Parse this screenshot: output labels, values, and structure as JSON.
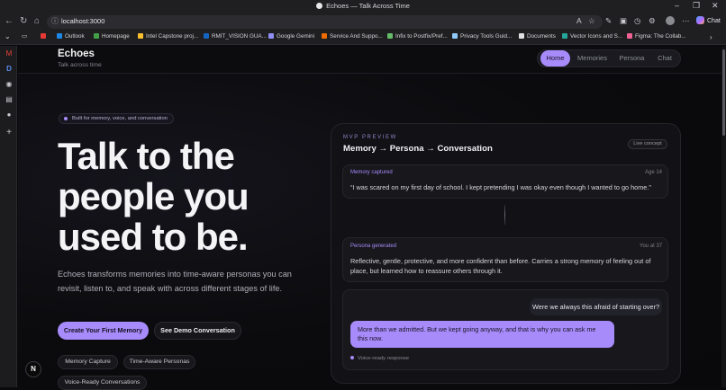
{
  "window": {
    "title": "Echoes — Talk Across Time",
    "controls": [
      "–",
      "❐",
      "✕"
    ]
  },
  "browser": {
    "url": "localhost:3000",
    "copilot_label": "Chat",
    "bookmarks": [
      {
        "label": "",
        "color": "#e53935"
      },
      {
        "label": "Outlook",
        "color": "#1e88e5"
      },
      {
        "label": "Homepage",
        "color": "#43a047"
      },
      {
        "label": "Intel Capstone proj...",
        "color": "#fbc02d"
      },
      {
        "label": "RMIT_VISION GUA...",
        "color": "#1565c0"
      },
      {
        "label": "Google Gemini",
        "color": "#8e8ef5"
      },
      {
        "label": "Service And Suppo...",
        "color": "#ef6c00"
      },
      {
        "label": "Infix to Postfix/Pref...",
        "color": "#66bb6a"
      },
      {
        "label": "Privacy Tools Guid...",
        "color": "#90caf9"
      },
      {
        "label": "Documents",
        "color": "#e0e0e0"
      },
      {
        "label": "Vector Icons and S...",
        "color": "#26a69a"
      },
      {
        "label": "Figma: The Collab...",
        "color": "#f06292"
      }
    ]
  },
  "app": {
    "brand": "Echoes",
    "tagline": "Talk across time",
    "nav": [
      "Home",
      "Memories",
      "Persona",
      "Chat"
    ],
    "active_nav": "Home"
  },
  "hero": {
    "badge": "Built for memory, voice, and conversation",
    "headline": "Talk to the people you used to be.",
    "description": "Echoes transforms memories into time-aware personas you can revisit, listen to, and speak with across different stages of life.",
    "primary_cta": "Create Your First Memory",
    "secondary_cta": "See Demo Conversation",
    "chips": [
      "Memory Capture",
      "Time-Aware Personas",
      "Voice-Ready Conversations"
    ]
  },
  "preview": {
    "eyebrow": "MVP PREVIEW",
    "title": "Memory → Persona → Conversation",
    "status": "Live concept",
    "memory": {
      "label": "Memory captured",
      "meta": "Age 14",
      "text": "“I was scared on my first day of school. I kept pretending I was okay even though I wanted to go home.”"
    },
    "persona": {
      "label": "Persona generated",
      "meta": "You at 37",
      "text": "Reflective, gentle, protective, and more confident than before. Carries a strong memory of feeling out of place, but learned how to reassure others through it."
    },
    "chat": {
      "question": "Were we always this afraid of starting over?",
      "answer": "More than we admitted. But we kept going anyway, and that is why you can ask me this now.",
      "voice_note": "Voice-ready response"
    }
  },
  "overlay": {
    "dev_badge": "N"
  },
  "colors": {
    "accent": "#a78bfa",
    "background": "#0a0a0c"
  }
}
